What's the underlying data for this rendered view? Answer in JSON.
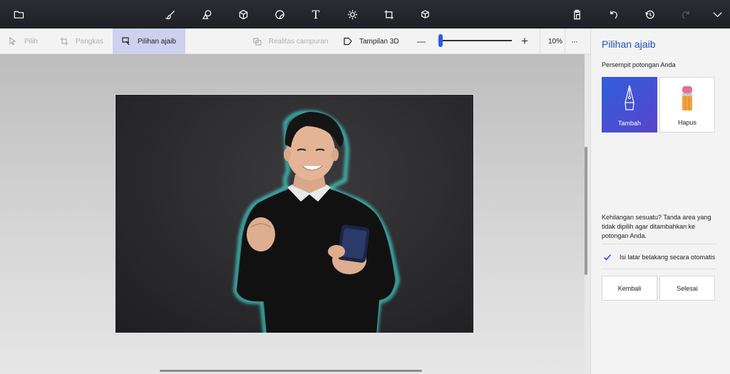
{
  "toolbar": {
    "icons": [
      "folder-icon",
      "brush-icon",
      "2d-shapes-icon",
      "3d-shapes-icon",
      "stickers-icon",
      "text-icon",
      "effects-icon",
      "canvas-icon",
      "3d-library-icon",
      "paste-icon",
      "undo-icon",
      "history-icon",
      "redo-icon",
      "expand-icon"
    ],
    "text_glyph": "T"
  },
  "subbar": {
    "select_label": "Pilih",
    "crop_label": "Pangkas",
    "magic_select_label": "Pilihan ajaib",
    "mixed_reality_label": "Realitas campuran",
    "view_3d_label": "Tampilan 3D",
    "zoom_minus": "—",
    "zoom_plus": "+",
    "zoom_value": "10%",
    "zoom_fraction": 0.03,
    "more_label": "···"
  },
  "panel": {
    "title": "Pilihan ajaib",
    "subtitle": "Persempit potongan Anda",
    "add_label": "Tambah",
    "remove_label": "Hapus",
    "hint": "Kehilangan sesuatu? Tanda area yang tidak dipilih agar ditambahkan ke potongan Anda.",
    "autofill_label": "Isi latar belakang secara otomatis",
    "autofill_checked": true,
    "back_label": "Kembali",
    "done_label": "Selesai"
  },
  "colors": {
    "accent": "#1e4fb8",
    "active_tool_bg": "#ccd1ee",
    "toolbar_bg": "#2b2d33"
  }
}
